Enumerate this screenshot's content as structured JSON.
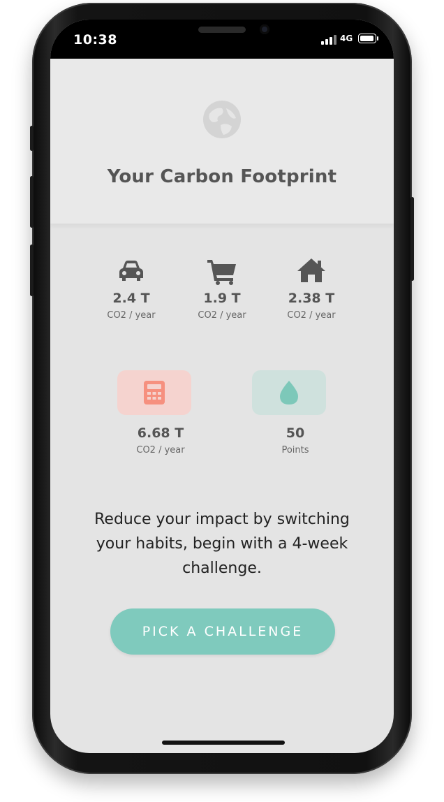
{
  "status_bar": {
    "time": "10:38",
    "network": "4G"
  },
  "header": {
    "icon": "globe-icon",
    "title": "Your Carbon Footprint"
  },
  "stats": [
    {
      "icon": "car-icon",
      "value": "2.4 T",
      "unit": "CO2 / year"
    },
    {
      "icon": "cart-icon",
      "value": "1.9 T",
      "unit": "CO2 / year"
    },
    {
      "icon": "home-icon",
      "value": "2.38 T",
      "unit": "CO2 / year"
    }
  ],
  "totals": [
    {
      "icon": "calculator-icon",
      "value": "6.68 T",
      "unit": "CO2 / year",
      "tile_color": "#f5d3cf",
      "icon_color": "#f6907f"
    },
    {
      "icon": "water-drop-icon",
      "value": "50",
      "unit": "Points",
      "tile_color": "#cfe1dd",
      "icon_color": "#7dc8b9"
    }
  ],
  "message": "Reduce your impact by switching your habits, begin with a 4-week challenge.",
  "cta": {
    "label": "PICK A CHALLENGE"
  },
  "colors": {
    "accent": "#7fcabd",
    "text_primary": "#555555",
    "background": "#e4e4e4"
  }
}
